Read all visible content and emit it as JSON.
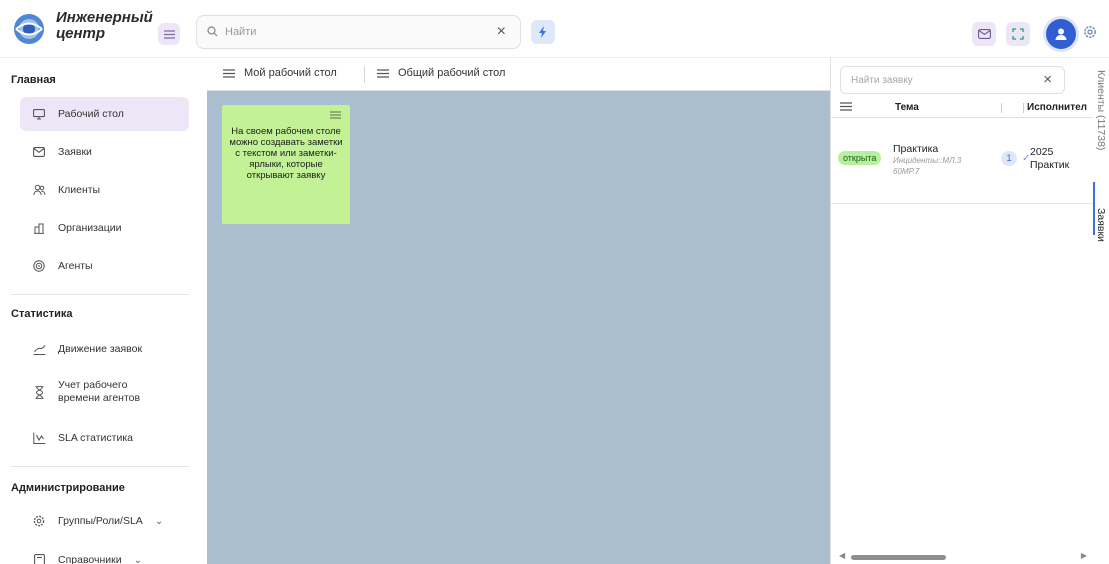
{
  "header": {
    "app_name_line1": "Инженерный",
    "app_name_line2": "центр",
    "search_placeholder": "Найти",
    "search_clear": "×",
    "icons": [
      "logo",
      "menu-icon",
      "search-icon",
      "bolt-icon",
      "mail-icon",
      "fullscreen-icon",
      "user-icon",
      "gear-icon"
    ]
  },
  "sidebar": {
    "sections": [
      {
        "title": "Главная",
        "items": [
          {
            "label": "Рабочий стол",
            "icon": "desktop-icon",
            "active": true
          },
          {
            "label": "Заявки",
            "icon": "mail-icon"
          },
          {
            "label": "Клиенты",
            "icon": "clients-icon"
          },
          {
            "label": "Организации",
            "icon": "organization-icon"
          },
          {
            "label": "Агенты",
            "icon": "agents-icon"
          }
        ]
      },
      {
        "title": "Статистика",
        "items": [
          {
            "label": "Движение заявок",
            "icon": "chart-icon"
          },
          {
            "label": "Учет рабочего времени агентов",
            "icon": "hourglass-icon"
          },
          {
            "label": "SLA статистика",
            "icon": "sla-chart-icon"
          }
        ]
      },
      {
        "title": "Администрирование",
        "items": [
          {
            "label": "Группы/Роли/SLA",
            "icon": "settings-icon",
            "chevron": "⌄"
          },
          {
            "label": "Справочники",
            "icon": "book-icon",
            "chevron": "⌄"
          }
        ]
      }
    ]
  },
  "desk": {
    "tabs": [
      {
        "label": "Мой рабочий стол",
        "active": true
      },
      {
        "label": "Общий рабочий стол",
        "active": false
      }
    ],
    "note": {
      "text": "На своем рабочем столе можно создавать заметки с текстом или заметки-ярлыки, которые открывают заявку",
      "color": "#c2f295"
    },
    "background": "#abbed0"
  },
  "right_panel": {
    "search_placeholder": "Найти заявку",
    "search_clear": "×",
    "columns": [
      "Тема",
      "Исполнител"
    ],
    "rows": [
      {
        "status": "открыта",
        "title": "Практика",
        "subtitle": "Инциденты::МЛ.360МР.7",
        "count": "1",
        "check": "✓",
        "date": "2025",
        "executor": "Практик"
      }
    ]
  },
  "side_tabs": {
    "clients": "Клиенты (11738)",
    "tickets": "Заявки"
  },
  "colors": {
    "accent": "#2f5fd0",
    "active_item_bg": "#ece6f6",
    "status_open_bg": "#b7ef9c"
  }
}
